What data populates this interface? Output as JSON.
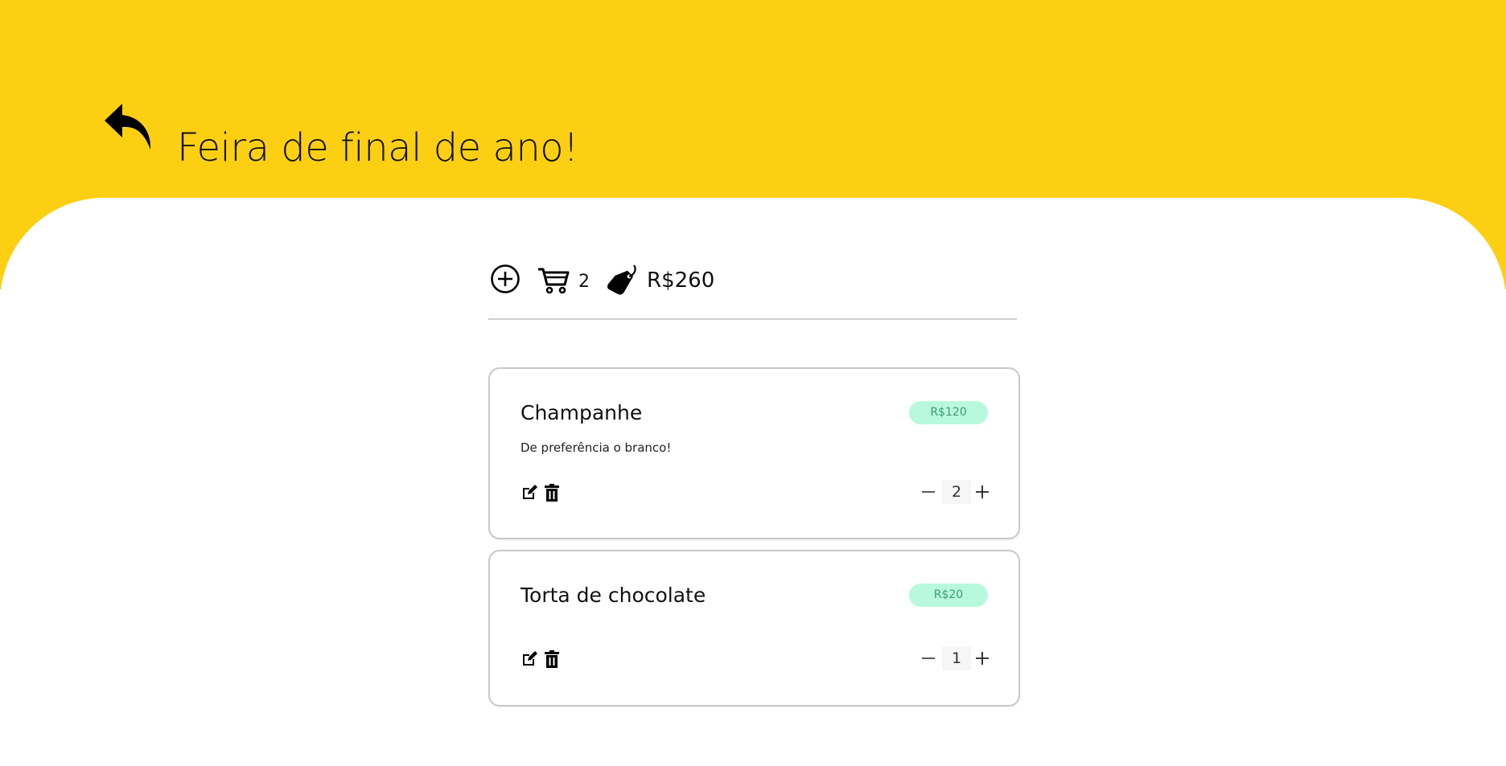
{
  "header": {
    "title": "Feira de final de ano!",
    "back_icon": "reply-arrow-icon",
    "background_color": "#fdcf12"
  },
  "toolbar": {
    "add_icon": "plus-circle-icon",
    "cart_icon": "shopping-cart-icon",
    "item_count": "2",
    "tag_icon": "price-tag-icon",
    "total": "R$260"
  },
  "items": [
    {
      "name": "Champanhe",
      "price": "R$120",
      "description": "De preferência o branco!",
      "quantity": "2",
      "edit_icon": "edit-icon",
      "delete_icon": "trash-icon"
    },
    {
      "name": "Torta de chocolate",
      "price": "R$20",
      "description": "",
      "quantity": "1",
      "edit_icon": "edit-icon",
      "delete_icon": "trash-icon"
    }
  ],
  "colors": {
    "accent": "#fdcf12",
    "price_badge_bg": "#b8f9dd",
    "price_badge_text": "#3e9b73"
  }
}
